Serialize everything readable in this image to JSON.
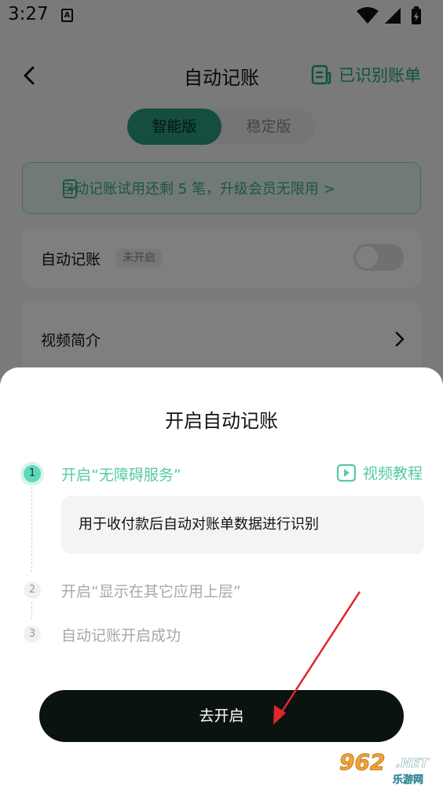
{
  "status_bar": {
    "time": "3:27",
    "notification_icon": "A"
  },
  "header": {
    "title": "自动记账",
    "bills_link": "已识别账单"
  },
  "tabs": [
    {
      "label": "智能版",
      "active": true
    },
    {
      "label": "稳定版",
      "active": false
    }
  ],
  "trial_banner": "自动记账试用还剩 5 笔，升级会员无限用 >",
  "auto_card": {
    "label": "自动记账",
    "badge": "未开启",
    "toggle_on": false
  },
  "video_card": {
    "label": "视频简介"
  },
  "sheet": {
    "title": "开启自动记账",
    "video_tutorial": "视频教程",
    "steps": [
      {
        "num": "1",
        "label": "开启“无障碍服务”",
        "state": "active",
        "desc": "用于收付款后自动对账单数据进行识别"
      },
      {
        "num": "2",
        "label": "开启“显示在其它应用上层”",
        "state": "pending"
      },
      {
        "num": "3",
        "label": "自动记账开启成功",
        "state": "pending"
      }
    ],
    "action_button": "去开启"
  },
  "watermark": {
    "brand": "962",
    "suffix": ".NET",
    "cn": "乐游网"
  },
  "colors": {
    "accent": "#55c9a8",
    "accent_dark": "#2a9a7d",
    "button_bg": "#0a1310",
    "annotation_arrow": "#e0262a"
  },
  "icons": [
    "back-arrow-icon",
    "bill-list-icon",
    "play-video-icon",
    "chevron-right-icon",
    "wifi-icon",
    "cell-signal-icon",
    "battery-icon"
  ]
}
